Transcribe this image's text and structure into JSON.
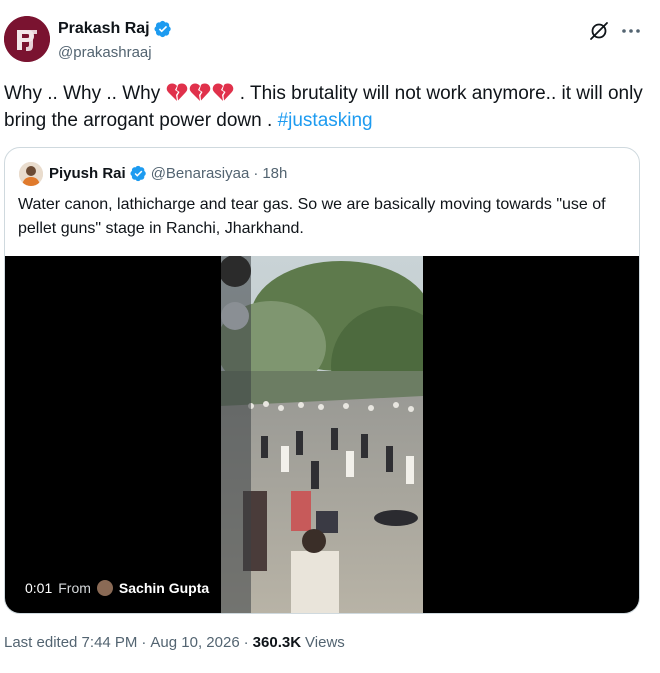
{
  "author": {
    "display_name": "Prakash Raj",
    "handle": "@prakashraaj",
    "avatar_icon": "prakash-raj-logo-icon",
    "verified": true
  },
  "tweet": {
    "text_a": "Why .. Why .. Why ",
    "emoji_icon": "broken-heart-icon",
    "text_b": " . This brutality will not work anymore.. it will only bring the arrogant power down . ",
    "hashtag": "#justasking"
  },
  "quoted": {
    "display_name": "Piyush Rai",
    "handle": "@Benarasiyaa",
    "separator": "·",
    "time": "18h",
    "text": "Water canon, lathicharge and tear gas. So we are basically moving towards \"use of pellet guns\" stage in Ranchi, Jharkhand.",
    "video": {
      "time": "0:01",
      "from_label": "From",
      "from_name": "Sachin Gupta"
    }
  },
  "meta": {
    "edited": "Last edited 7:44 PM",
    "separator": "·",
    "date": "Aug 10, 2026",
    "views_count": "360.3K",
    "views_label": "Views"
  },
  "colors": {
    "accent": "#1d9bf0",
    "text": "#0f1419",
    "secondary": "#536471",
    "border": "#cfd9de",
    "avatar_bg": "#7a1330",
    "broken_heart": "#e0314b"
  }
}
